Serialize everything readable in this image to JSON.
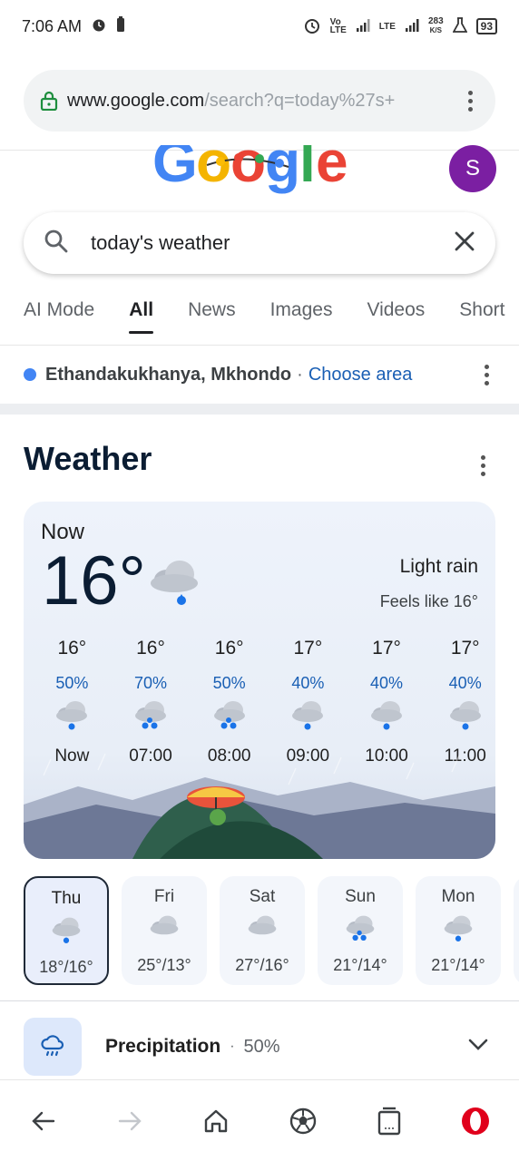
{
  "status": {
    "time": "7:06 AM",
    "network_speed_top": "283",
    "network_speed_bottom": "K/S",
    "volte_top": "Vo",
    "volte_bottom": "LTE",
    "lte_label": "LTE",
    "battery": "93"
  },
  "browser": {
    "url_host": "www.google.com",
    "url_path": "/search?q=today%27s+"
  },
  "account": {
    "avatar_letter": "S"
  },
  "search": {
    "query": "today's weather"
  },
  "tabs": [
    "AI Mode",
    "All",
    "News",
    "Images",
    "Videos",
    "Short"
  ],
  "active_tab": "All",
  "location": {
    "name": "Ethandakukhanya, Mkhondo",
    "separator": "·",
    "action": "Choose area"
  },
  "weather": {
    "title": "Weather",
    "now_label": "Now",
    "current_temp": "16°",
    "condition": "Light rain",
    "feels_like": "Feels like 16°",
    "hourly": [
      {
        "temp": "16°",
        "precip": "50%",
        "time": "Now",
        "icon": "light-rain-icon"
      },
      {
        "temp": "16°",
        "precip": "70%",
        "time": "07:00",
        "icon": "rain-icon"
      },
      {
        "temp": "16°",
        "precip": "50%",
        "time": "08:00",
        "icon": "rain-icon"
      },
      {
        "temp": "17°",
        "precip": "40%",
        "time": "09:00",
        "icon": "light-rain-icon"
      },
      {
        "temp": "17°",
        "precip": "40%",
        "time": "10:00",
        "icon": "light-rain-icon"
      },
      {
        "temp": "17°",
        "precip": "40%",
        "time": "11:00",
        "icon": "light-rain-icon"
      }
    ],
    "daily": [
      {
        "day": "Thu",
        "range": "18°/16°",
        "icon": "light-rain-icon",
        "selected": true
      },
      {
        "day": "Fri",
        "range": "25°/13°",
        "icon": "cloud-icon",
        "selected": false
      },
      {
        "day": "Sat",
        "range": "27°/16°",
        "icon": "cloud-icon",
        "selected": false
      },
      {
        "day": "Sun",
        "range": "21°/14°",
        "icon": "rain-icon",
        "selected": false
      },
      {
        "day": "Mon",
        "range": "21°/14°",
        "icon": "light-rain-icon",
        "selected": false
      }
    ]
  },
  "precipitation": {
    "label": "Precipitation",
    "dot": "·",
    "value": "50%"
  },
  "colors": {
    "accent_blue": "#1a5fb4",
    "avatar_purple": "#7b1fa2",
    "opera_red": "#e0001b"
  }
}
